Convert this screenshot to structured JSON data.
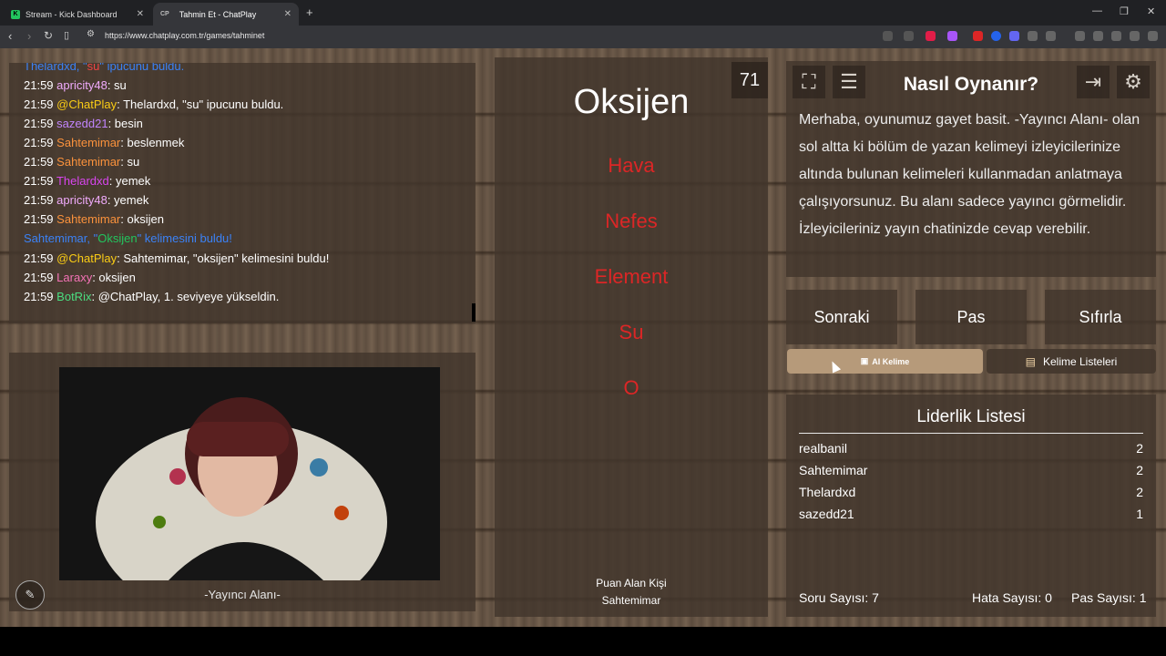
{
  "browser": {
    "tabs": [
      {
        "title": "Stream - Kick Dashboard",
        "favicon": "K"
      },
      {
        "title": "Tahmin Et - ChatPlay",
        "favicon": "CP"
      }
    ],
    "url": "https://www.chatplay.com.tr/games/tahminet"
  },
  "chat": {
    "messages": [
      {
        "time": "",
        "user": "Thelardxd, \"",
        "text": "su\" ipucunu buldu.",
        "system": true
      },
      {
        "time": "21:59",
        "user": "apricity48",
        "color": "#f0abfc",
        "text": ": su"
      },
      {
        "time": "21:59",
        "user": "@ChatPlay",
        "color": "#facc15",
        "text": ": Thelardxd, \"su\" ipucunu buldu."
      },
      {
        "time": "21:59",
        "user": "sazedd21",
        "color": "#c084fc",
        "text": ": besin"
      },
      {
        "time": "21:59",
        "user": "Sahtemimar",
        "color": "#fb923c",
        "text": ": beslenmek"
      },
      {
        "time": "21:59",
        "user": "Sahtemimar",
        "color": "#fb923c",
        "text": ": su"
      },
      {
        "time": "21:59",
        "user": "Thelardxd",
        "color": "#d946ef",
        "text": ": yemek"
      },
      {
        "time": "21:59",
        "user": "apricity48",
        "color": "#f0abfc",
        "text": ": yemek"
      },
      {
        "time": "21:59",
        "user": "Sahtemimar",
        "color": "#fb923c",
        "text": ": oksijen"
      },
      {
        "time": "",
        "user": "Sahtemimar, \"",
        "text": "Oksijen\" kelimesini buldu!",
        "system": true
      },
      {
        "time": "21:59",
        "user": "@ChatPlay",
        "color": "#facc15",
        "text": ": Sahtemimar, \"oksijen\" kelimesini buldu!"
      },
      {
        "time": "21:59",
        "user": "Laraxy",
        "color": "#f472b6",
        "text": ": oksijen"
      },
      {
        "time": "21:59",
        "user": "BotRix",
        "color": "#4ade80",
        "text": ": @ChatPlay, 1. seviyeye yükseldin."
      }
    ]
  },
  "webcam": {
    "label": "-Yayıncı Alanı-"
  },
  "game": {
    "counter": "71",
    "word": "Oksijen",
    "taboo": [
      "Hava",
      "Nefes",
      "Element",
      "Su",
      "O"
    ],
    "scorer_label": "Puan Alan Kişi",
    "scorer_name": "Sahtemimar"
  },
  "info": {
    "title": "Nasıl Oynanır?",
    "text": "Merhaba, oyunumuz gayet basit. -Yayıncı Alanı- olan sol altta ki bölüm de yazan kelimeyi izleyicilerinize altında bulunan kelimeleri kullanmadan anlatmaya çalışıyorsunuz. Bu alanı sadece yayıncı görmelidir. İzleyicileriniz yayın chatinizde cevap verebilir."
  },
  "buttons": {
    "next": "Sonraki",
    "pass": "Pas",
    "reset": "Sıfırla",
    "ai_word": "AI Kelime",
    "word_lists": "Kelime Listeleri"
  },
  "leaderboard": {
    "title": "Liderlik Listesi",
    "rows": [
      {
        "name": "realbanil",
        "score": "2"
      },
      {
        "name": "Sahtemimar",
        "score": "2"
      },
      {
        "name": "Thelardxd",
        "score": "2"
      },
      {
        "name": "sazedd21",
        "score": "1"
      }
    ],
    "question_count": "Soru Sayısı: 7",
    "error_count": "Hata Sayısı: 0",
    "pass_count": "Pas Sayısı: 1"
  }
}
